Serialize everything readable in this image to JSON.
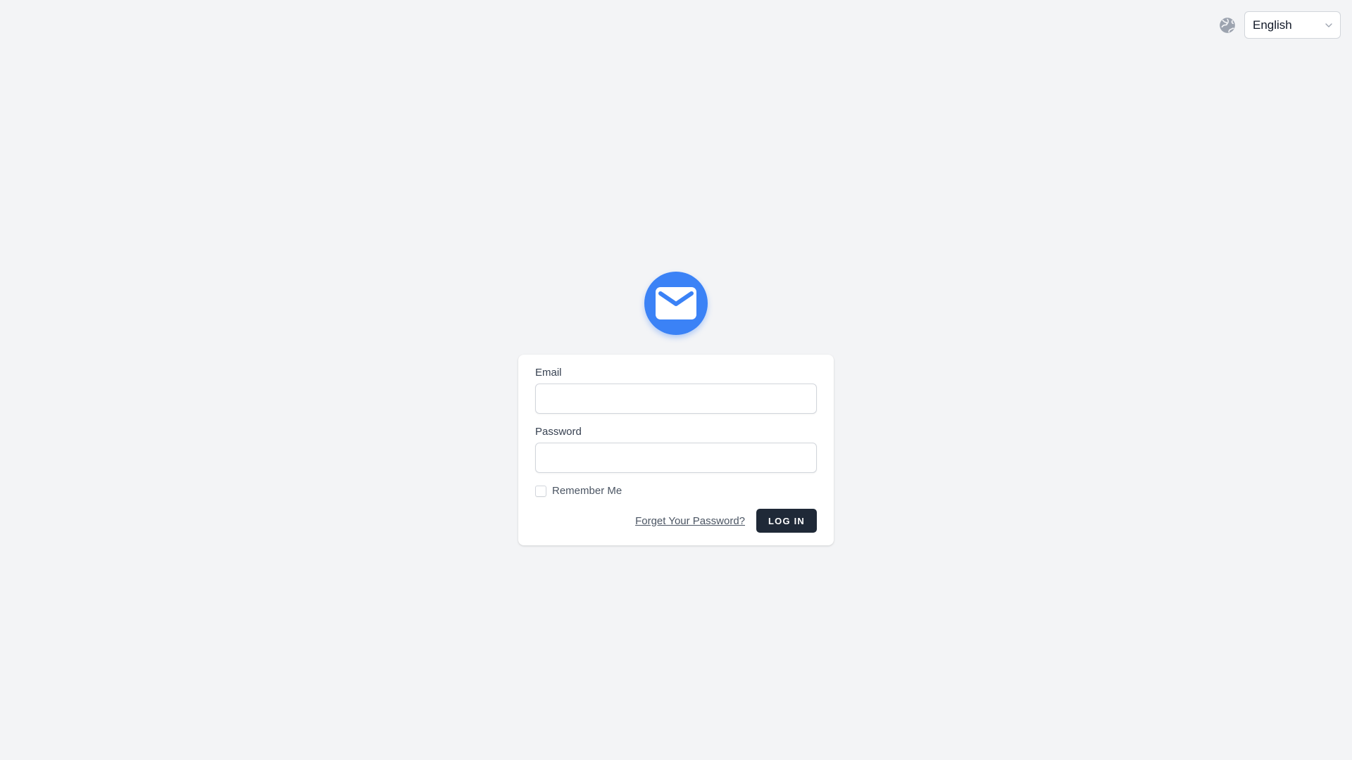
{
  "header": {
    "globe_icon": "globe-icon",
    "language_select": {
      "selected": "English",
      "icon": "chevron-down-icon"
    }
  },
  "logo": {
    "icon": "envelope-icon",
    "color": "#3b82f6"
  },
  "form": {
    "email_label": "Email",
    "email_value": "",
    "password_label": "Password",
    "password_value": "",
    "remember_label": "Remember Me",
    "remember_checked": false,
    "forgot_link": "Forget Your Password?",
    "login_button": "LOG IN"
  },
  "colors": {
    "background": "#f3f4f6",
    "button": "#1f2937",
    "accent": "#3b82f6"
  }
}
